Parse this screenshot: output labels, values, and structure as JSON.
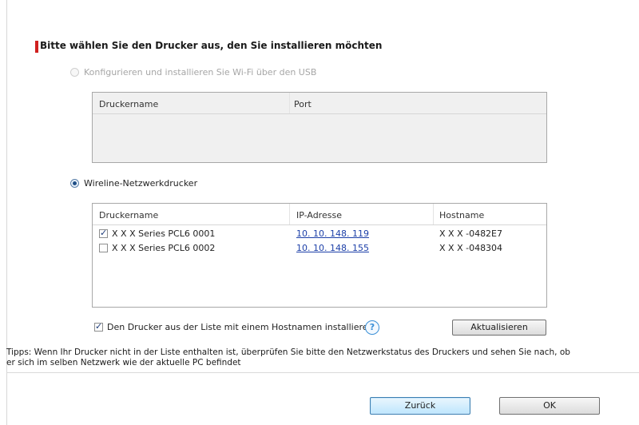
{
  "header": {
    "title": "Bitte wählen Sie den Drucker aus, den Sie installieren möchten"
  },
  "usb_section": {
    "radio_label": "Konfigurieren und installieren Sie Wi-Fi über den USB",
    "selected": false,
    "enabled": false,
    "columns": [
      "Druckername",
      "Port"
    ]
  },
  "network_section": {
    "radio_label": "Wireline-Netzwerkdrucker",
    "selected": true,
    "columns": [
      "Druckername",
      "IP-Adresse",
      "Hostname"
    ],
    "printers": [
      {
        "checked": true,
        "name": "X X X  Series PCL6 0001",
        "ip": "10. 10. 148. 119",
        "hostname": "X X X -0482E7"
      },
      {
        "checked": false,
        "name": "X X X  Series PCL6 0002",
        "ip": "10. 10. 148. 155",
        "hostname": "X X X -048304"
      }
    ]
  },
  "options": {
    "hostname_checkbox_label": "Den Drucker aus der Liste mit einem Hostnamen installieren",
    "hostname_checkbox_checked": true,
    "help_symbol": "?",
    "refresh_label": "Aktualisieren"
  },
  "tip": {
    "text": "Tipps: Wenn Ihr Drucker nicht in der Liste enthalten ist, überprüfen Sie bitte den Netzwerkstatus des Druckers und sehen Sie nach, ob er sich im selben Netzwerk wie der aktuelle PC befindet"
  },
  "footer": {
    "back_label": "Zurück",
    "ok_label": "OK"
  },
  "colors": {
    "accent_bar": "#d0201f",
    "link": "#1c3fa8"
  }
}
